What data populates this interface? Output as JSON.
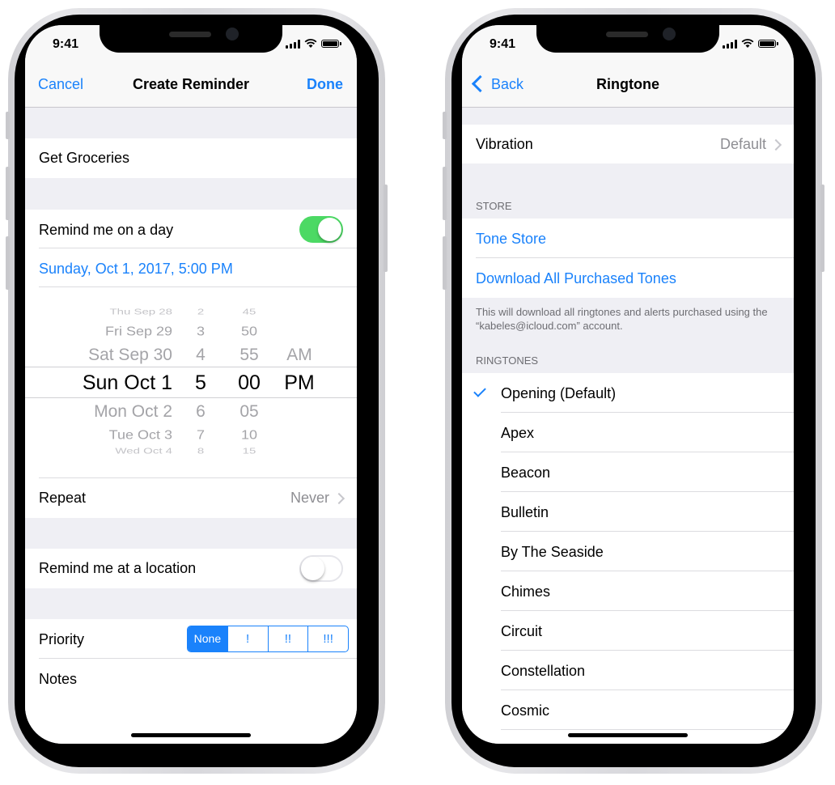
{
  "left_phone": {
    "status_time": "9:41",
    "nav": {
      "cancel_label": "Cancel",
      "title": "Create Reminder",
      "done_label": "Done"
    },
    "title_field": {
      "value": "Get Groceries"
    },
    "remind_day": {
      "label": "Remind me on a day",
      "toggle_on": true
    },
    "selected_datetime": "Sunday, Oct 1, 2017, 5:00 PM",
    "picker": {
      "dates": [
        "Thu Sep 28",
        "Fri Sep 29",
        "Sat Sep 30",
        "Sun Oct 1",
        "Mon Oct 2",
        "Tue Oct 3",
        "Wed Oct 4"
      ],
      "hours": [
        "2",
        "3",
        "4",
        "5",
        "6",
        "7",
        "8"
      ],
      "minutes": [
        "45",
        "50",
        "55",
        "00",
        "05",
        "10",
        "15"
      ],
      "ampm": [
        "AM",
        "PM"
      ]
    },
    "repeat": {
      "label": "Repeat",
      "value": "Never"
    },
    "remind_location": {
      "label": "Remind me at a location",
      "toggle_on": false
    },
    "priority": {
      "label": "Priority",
      "options": [
        "None",
        "!",
        "!!",
        "!!!"
      ],
      "selected": "None"
    },
    "notes": {
      "label": "Notes"
    }
  },
  "right_phone": {
    "status_time": "9:41",
    "nav": {
      "back_label": "Back",
      "title": "Ringtone"
    },
    "vibration": {
      "label": "Vibration",
      "value": "Default"
    },
    "store": {
      "header": "STORE",
      "tone_store_label": "Tone Store",
      "download_label": "Download All Purchased Tones",
      "footer": "This will download all ringtones and alerts purchased using the “kabeles@icloud.com” account."
    },
    "ringtones": {
      "header": "RINGTONES",
      "items": [
        "Opening (Default)",
        "Apex",
        "Beacon",
        "Bulletin",
        "By The Seaside",
        "Chimes",
        "Circuit",
        "Constellation",
        "Cosmic"
      ],
      "selected": "Opening (Default)"
    }
  },
  "colors": {
    "accent": "#1a82fb",
    "toggle_on": "#4cd964",
    "grouped_bg": "#efeff4"
  }
}
